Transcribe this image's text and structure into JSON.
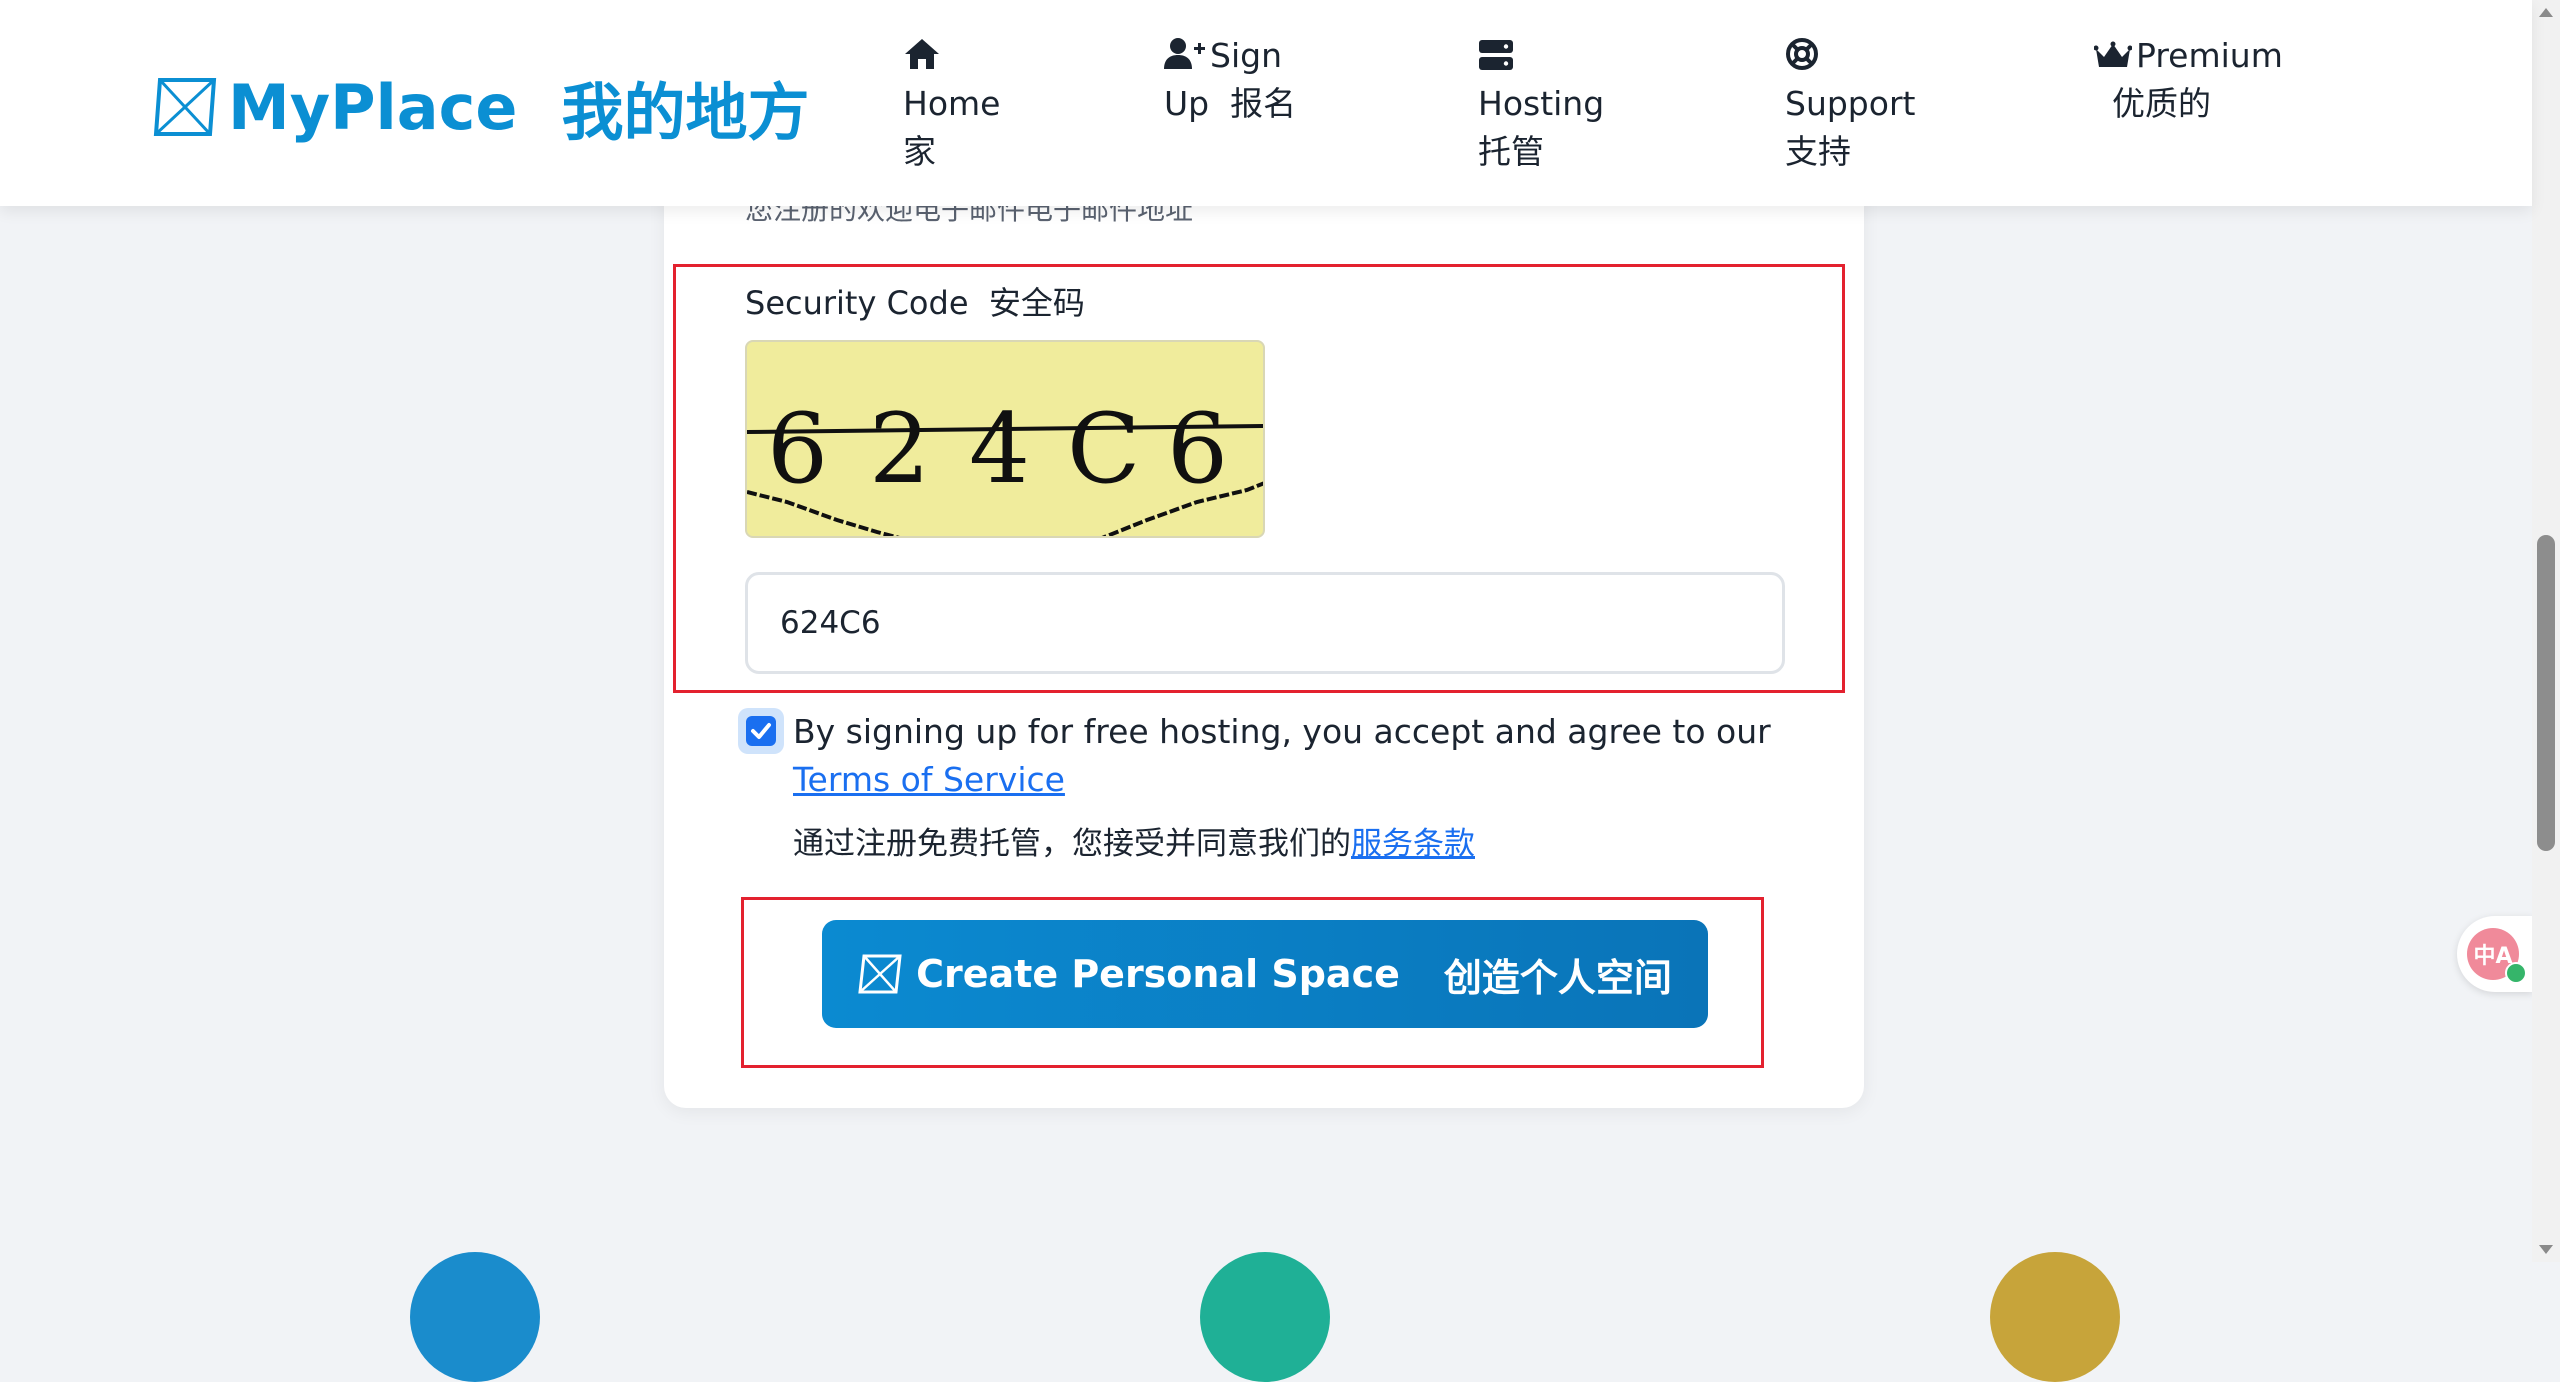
{
  "header": {
    "logo_text": "MyPlace",
    "logo_text_cn": "我的地方",
    "nav": [
      {
        "icon": "home-icon",
        "label": "Home",
        "label_cn": "家"
      },
      {
        "icon": "user-plus-icon",
        "label": "Sign Up",
        "label_line1": "Sign",
        "label_line2": "Up",
        "label_cn": "报名"
      },
      {
        "icon": "server-icon",
        "label": "Hosting",
        "label_cn": "托管"
      },
      {
        "icon": "lifebuoy-icon",
        "label": "Support",
        "label_cn": "支持"
      },
      {
        "icon": "crown-icon",
        "label": "Premium",
        "label_cn": "优质的"
      }
    ]
  },
  "form": {
    "email_hint_cn": "您注册的欢迎电子邮件电子邮件地址",
    "security_label": "Security Code",
    "security_label_cn": "安全码",
    "captcha_text": "624C6",
    "security_input_value": "624C6",
    "terms_checked": true,
    "terms_text": "By signing up for free hosting, you accept and agree to our",
    "terms_link": "Terms of Service",
    "terms_text_cn": "通过注册免费托管，您接受并同意我们的",
    "terms_link_cn": "服务条款",
    "create_button_label": "Create Personal Space",
    "create_button_label_cn": "创造个人空间"
  },
  "widget": {
    "label": "中A"
  },
  "colors": {
    "brand": "#0b8fd3",
    "highlight_box": "#e3212f",
    "link": "#1a6ff0",
    "captcha_bg": "#f0ec9c",
    "circle_blue": "#1a8ccc",
    "circle_teal": "#1fb096",
    "circle_gold": "#c7a43a"
  }
}
